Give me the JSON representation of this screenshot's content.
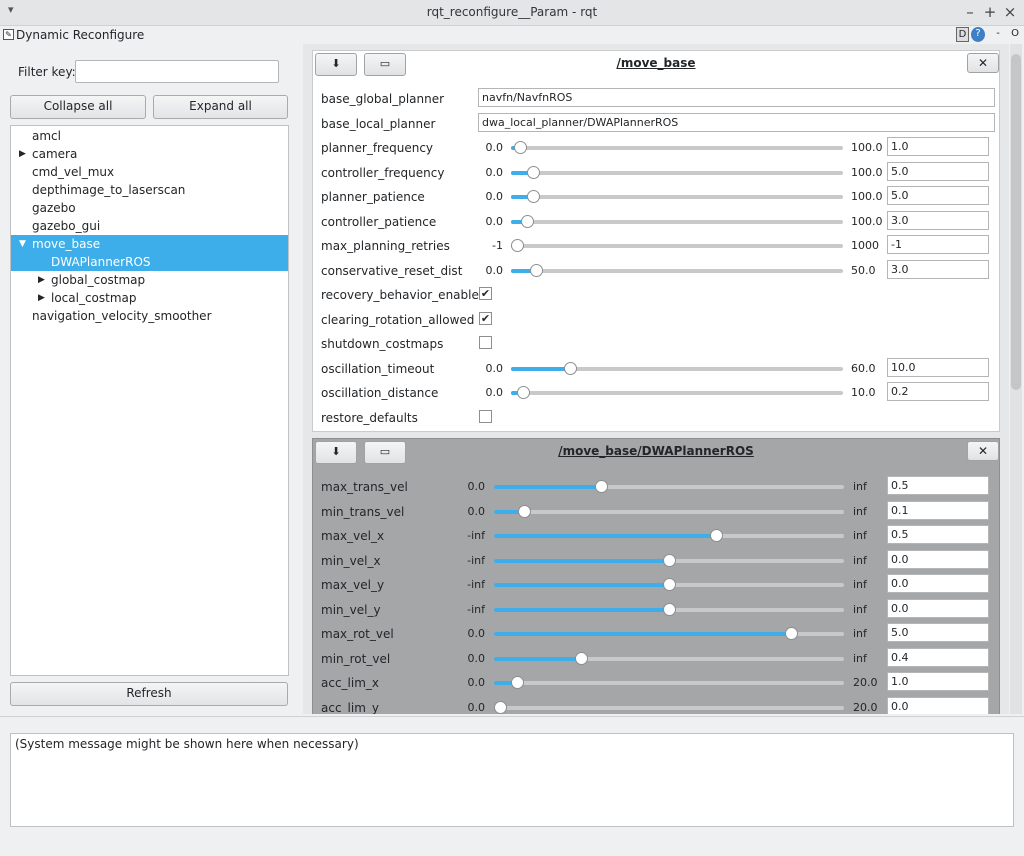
{
  "window": {
    "title": "rqt_reconfigure__Param - rqt",
    "menu_glyph": "▾",
    "min_glyph": "–",
    "max_glyph": "+",
    "close_glyph": "×"
  },
  "plugin": {
    "title": "Dynamic Reconfigure",
    "pen_glyph": "✎",
    "help_d": "D",
    "help_q": "?",
    "minus_glyph": "-",
    "o_glyph": "O"
  },
  "filter": {
    "label": "Filter key:",
    "value": ""
  },
  "buttons": {
    "collapse_all": "Collapse all",
    "expand_all": "Expand all",
    "refresh": "Refresh"
  },
  "tree": [
    {
      "label": "amcl",
      "depth": 0,
      "arrow": "",
      "selected": false
    },
    {
      "label": "camera",
      "depth": 0,
      "arrow": "▶",
      "selected": false
    },
    {
      "label": "cmd_vel_mux",
      "depth": 0,
      "arrow": "",
      "selected": false
    },
    {
      "label": "depthimage_to_laserscan",
      "depth": 0,
      "arrow": "",
      "selected": false
    },
    {
      "label": "gazebo",
      "depth": 0,
      "arrow": "",
      "selected": false
    },
    {
      "label": "gazebo_gui",
      "depth": 0,
      "arrow": "",
      "selected": false
    },
    {
      "label": "move_base",
      "depth": 0,
      "arrow": "▼",
      "selected": true
    },
    {
      "label": "DWAPlannerROS",
      "depth": 1,
      "arrow": "",
      "selected": true
    },
    {
      "label": "global_costmap",
      "depth": 1,
      "arrow": "▶",
      "selected": false
    },
    {
      "label": "local_costmap",
      "depth": 1,
      "arrow": "▶",
      "selected": false
    },
    {
      "label": "navigation_velocity_smoother",
      "depth": 0,
      "arrow": "",
      "selected": false
    }
  ],
  "groups": [
    {
      "title": "/move_base",
      "save_icon": "⬇",
      "open_icon": "▭",
      "close_icon": "✕",
      "params": [
        {
          "name": "base_global_planner",
          "kind": "text",
          "value": "navfn/NavfnROS"
        },
        {
          "name": "base_local_planner",
          "kind": "text",
          "value": "dwa_local_planner/DWAPlannerROS"
        },
        {
          "name": "planner_frequency",
          "kind": "slider",
          "min": "0.0",
          "max": "100.0",
          "value": "1.0",
          "fraction": 0.01
        },
        {
          "name": "controller_frequency",
          "kind": "slider",
          "min": "0.0",
          "max": "100.0",
          "value": "5.0",
          "fraction": 0.05
        },
        {
          "name": "planner_patience",
          "kind": "slider",
          "min": "0.0",
          "max": "100.0",
          "value": "5.0",
          "fraction": 0.05
        },
        {
          "name": "controller_patience",
          "kind": "slider",
          "min": "0.0",
          "max": "100.0",
          "value": "3.0",
          "fraction": 0.03
        },
        {
          "name": "max_planning_retries",
          "kind": "slider",
          "min": "-1",
          "max": "1000",
          "value": "-1",
          "fraction": 0.0
        },
        {
          "name": "conservative_reset_dist",
          "kind": "slider",
          "min": "0.0",
          "max": "50.0",
          "value": "3.0",
          "fraction": 0.06
        },
        {
          "name": "recovery_behavior_enabled",
          "kind": "check",
          "checked": true,
          "mark": "✔"
        },
        {
          "name": "clearing_rotation_allowed",
          "kind": "check",
          "checked": true,
          "mark": "✔"
        },
        {
          "name": "shutdown_costmaps",
          "kind": "check",
          "checked": false,
          "mark": ""
        },
        {
          "name": "oscillation_timeout",
          "kind": "slider",
          "min": "0.0",
          "max": "60.0",
          "value": "10.0",
          "fraction": 0.167
        },
        {
          "name": "oscillation_distance",
          "kind": "slider",
          "min": "0.0",
          "max": "10.0",
          "value": "0.2",
          "fraction": 0.02
        },
        {
          "name": "restore_defaults",
          "kind": "check",
          "checked": false,
          "mark": ""
        }
      ]
    },
    {
      "title": "/move_base/DWAPlannerROS",
      "save_icon": "⬇",
      "open_icon": "▭",
      "close_icon": "✕",
      "params": [
        {
          "name": "max_trans_vel",
          "kind": "slider",
          "min": "0.0",
          "max": "inf",
          "value": "0.5",
          "fraction": 0.3
        },
        {
          "name": "min_trans_vel",
          "kind": "slider",
          "min": "0.0",
          "max": "inf",
          "value": "0.1",
          "fraction": 0.07
        },
        {
          "name": "max_vel_x",
          "kind": "slider",
          "min": "-inf",
          "max": "inf",
          "value": "0.5",
          "fraction": 0.64
        },
        {
          "name": "min_vel_x",
          "kind": "slider",
          "min": "-inf",
          "max": "inf",
          "value": "0.0",
          "fraction": 0.5
        },
        {
          "name": "max_vel_y",
          "kind": "slider",
          "min": "-inf",
          "max": "inf",
          "value": "0.0",
          "fraction": 0.5
        },
        {
          "name": "min_vel_y",
          "kind": "slider",
          "min": "-inf",
          "max": "inf",
          "value": "0.0",
          "fraction": 0.5
        },
        {
          "name": "max_rot_vel",
          "kind": "slider",
          "min": "0.0",
          "max": "inf",
          "value": "5.0",
          "fraction": 0.86
        },
        {
          "name": "min_rot_vel",
          "kind": "slider",
          "min": "0.0",
          "max": "inf",
          "value": "0.4",
          "fraction": 0.24
        },
        {
          "name": "acc_lim_x",
          "kind": "slider",
          "min": "0.0",
          "max": "20.0",
          "value": "1.0",
          "fraction": 0.05
        },
        {
          "name": "acc_lim_y",
          "kind": "slider",
          "min": "0.0",
          "max": "20.0",
          "value": "0.0",
          "fraction": 0.0
        }
      ]
    }
  ],
  "status_message": "(System message might be shown here when necessary)"
}
